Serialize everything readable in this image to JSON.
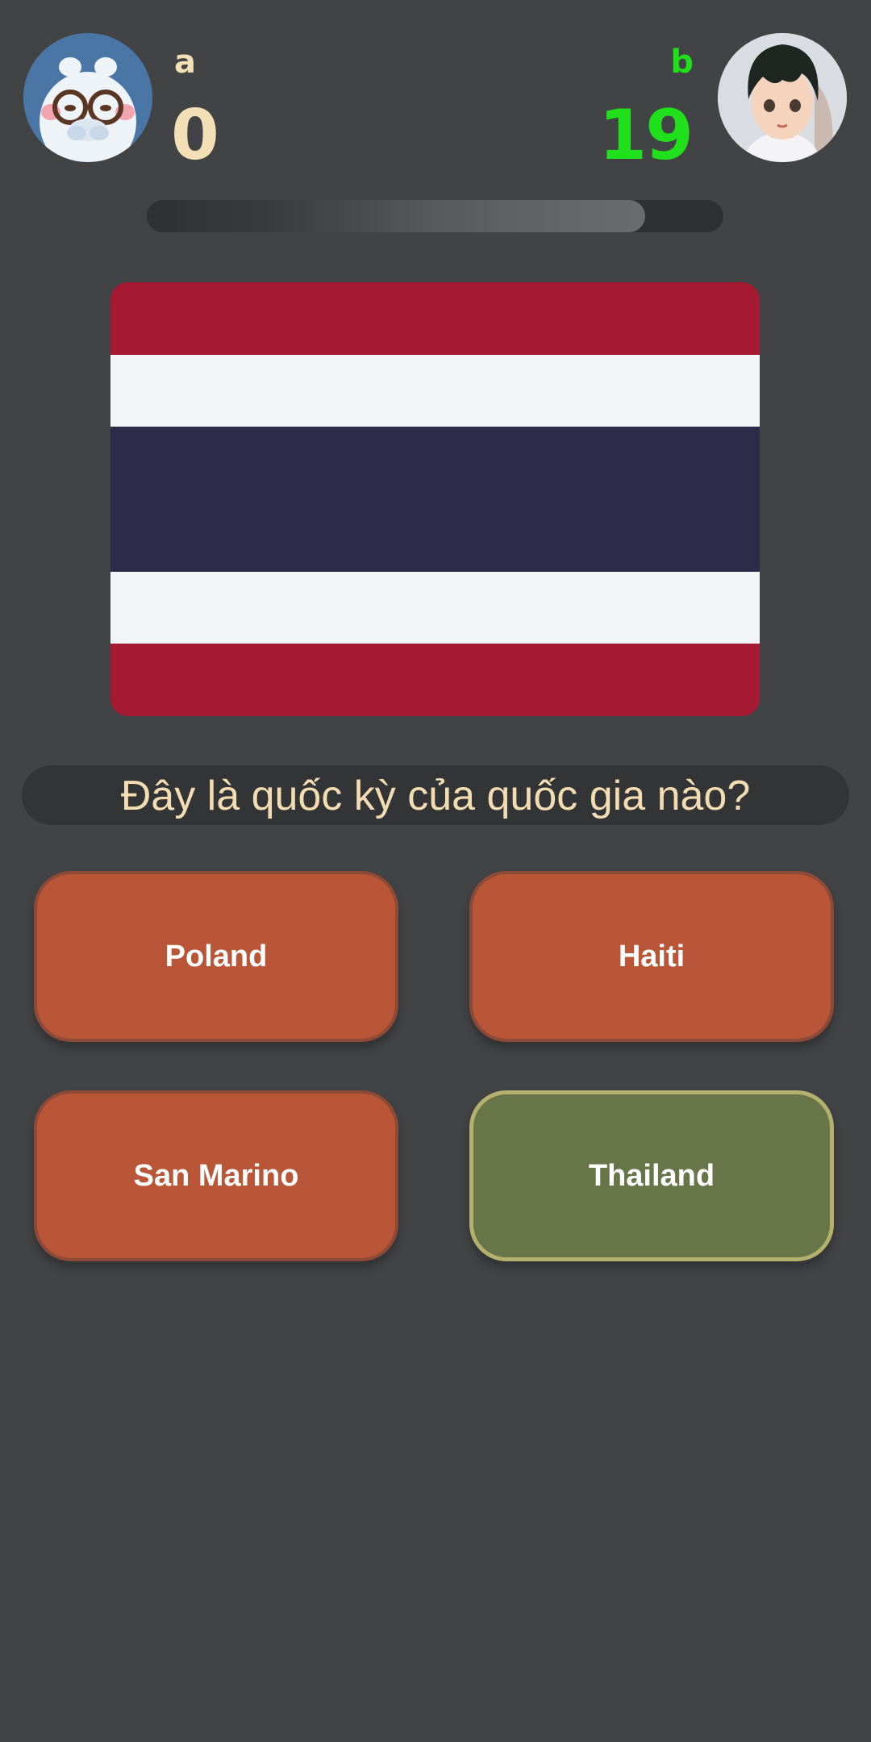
{
  "players": {
    "left": {
      "name": "a",
      "score": "0",
      "name_color": "#f3dfb5",
      "score_color": "#f3dfb5",
      "avatar": "bear-with-glasses-avatar"
    },
    "right": {
      "name": "b",
      "score": "19",
      "name_color": "#1fe01a",
      "score_color": "#1fe01a",
      "avatar": "anime-boy-avatar"
    }
  },
  "timer": {
    "remaining_fraction": 0.865
  },
  "flag": {
    "name": "thailand-flag",
    "stripes": [
      {
        "color": "#a51931",
        "weight": 1
      },
      {
        "color": "#f4f5f8",
        "weight": 1
      },
      {
        "color": "#2d2a4a",
        "weight": 2
      },
      {
        "color": "#f4f5f8",
        "weight": 1
      },
      {
        "color": "#a51931",
        "weight": 1
      }
    ]
  },
  "question": "Đây là quốc kỳ của quốc gia nào?",
  "answers": [
    {
      "label": "Poland",
      "state": "wrong"
    },
    {
      "label": "Haiti",
      "state": "wrong"
    },
    {
      "label": "San Marino",
      "state": "wrong"
    },
    {
      "label": "Thailand",
      "state": "correct"
    }
  ],
  "colors": {
    "background": "#424345",
    "wrong_answer": "#b85637",
    "correct_answer": "#687548",
    "correct_border": "#b3b16d",
    "question_text": "#f2dcb2"
  }
}
